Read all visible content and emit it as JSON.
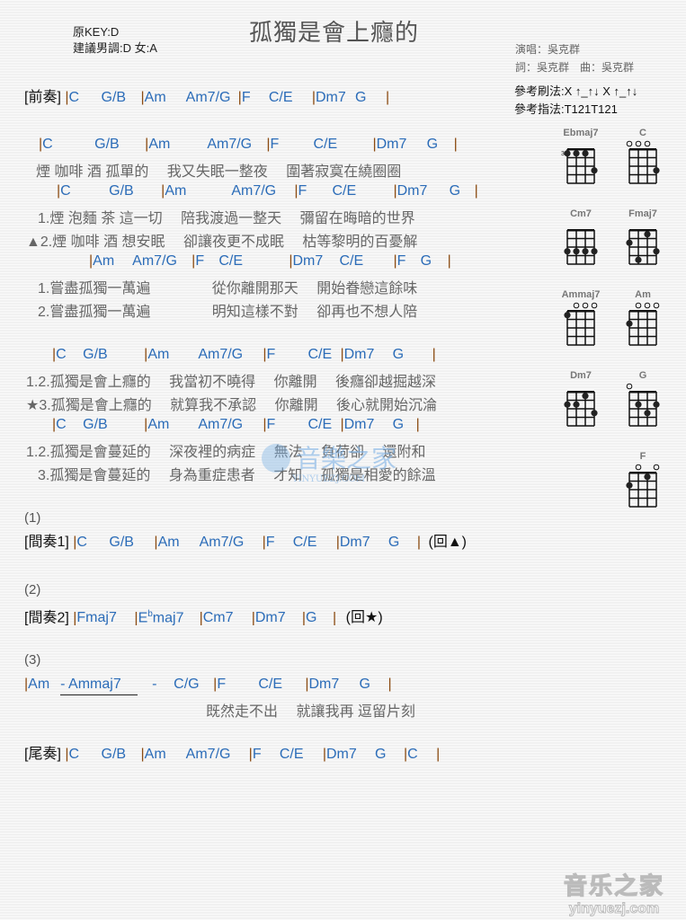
{
  "header": {
    "original_key": "原KEY:D",
    "suggested_key": "建議男調:D 女:A",
    "title": "孤獨是會上癮的",
    "singer": "演唱：吳克群",
    "credits": "詞：吳克群　曲：吳克群",
    "strum": "參考刷法:X ↑_↑↓ X ↑_↑↓",
    "finger": "參考指法:T121T121"
  },
  "intro": {
    "label": "[前奏]",
    "chords": [
      "C",
      "G/B",
      "Am",
      "Am7/G",
      "F",
      "C/E",
      "Dm7",
      "G"
    ]
  },
  "verse": {
    "chords1": [
      "C",
      "G/B",
      "Am",
      "Am7/G",
      "F",
      "C/E",
      "Dm7",
      "G"
    ],
    "lyric1": "煙 咖啡 酒 孤單的　 我又失眠一整夜　 圍著寂寞在繞圈圈",
    "chords2": [
      "C",
      "G/B",
      "Am",
      "Am7/G",
      "F",
      "C/E",
      "Dm7",
      "G"
    ],
    "lyric2a": "1.煙 泡麵 茶 這一切　 陪我渡過一整天　 彌留在晦暗的世界",
    "lyric2b": "▲2.煙 咖啡 酒 想安眠　 卻讓夜更不成眠　 枯等黎明的百憂解",
    "chords3": [
      "Am",
      "Am7/G",
      "F",
      "C/E",
      "Dm7",
      "C/E",
      "F",
      "G"
    ],
    "lyric3a": "1.嘗盡孤獨一萬遍　　　　 從你離開那天　 開始眷戀這餘味",
    "lyric3b": "2.嘗盡孤獨一萬遍　　　　 明知這樣不對　 卻再也不想人陪"
  },
  "chorus": {
    "chords1": [
      "C",
      "G/B",
      "Am",
      "Am7/G",
      "F",
      "C/E",
      "Dm7",
      "G"
    ],
    "lyric1a": "1.2.孤獨是會上癮的　 我當初不曉得　 你離開　 後癮卻越掘越深",
    "lyric1b": "★3.孤獨是會上癮的　 就算我不承認　 你離開　 後心就開始沉淪",
    "chords2": [
      "C",
      "G/B",
      "Am",
      "Am7/G",
      "F",
      "C/E",
      "Dm7",
      "G"
    ],
    "lyric2a": "1.2.孤獨是會蔓延的　 深夜裡的病症　 無法　 負荷卻　 還附和",
    "lyric2b": "3.孤獨是會蔓延的　 身為重症患者　 才知　 孤獨是相愛的餘溫"
  },
  "section1": {
    "marker": "(1)",
    "label": "[間奏1]",
    "chords": [
      "C",
      "G/B",
      "Am",
      "Am7/G",
      "F",
      "C/E",
      "Dm7",
      "G"
    ],
    "return": "(回▲)"
  },
  "section2": {
    "marker": "(2)",
    "label": "[間奏2]",
    "chords": [
      "Fmaj7",
      "E",
      "b",
      "maj7",
      "Cm7",
      "Dm7",
      "G"
    ],
    "return": "(回★)"
  },
  "section3": {
    "marker": "(3)",
    "chords": [
      "Am",
      "-  Ammaj7",
      "-",
      "C/G",
      "F",
      "C/E",
      "Dm7",
      "G"
    ],
    "lyric": "既然走不出　 就讓我再 逗留片刻"
  },
  "outro": {
    "label": "[尾奏]",
    "chords": [
      "C",
      "G/B",
      "Am",
      "Am7/G",
      "F",
      "C/E",
      "Dm7",
      "G",
      "C"
    ]
  },
  "chord_diagrams": [
    {
      "name": "Ebmaj7",
      "open": [],
      "fret_label": "3",
      "dots": [
        [
          1,
          1
        ],
        [
          2,
          1
        ],
        [
          3,
          1
        ],
        [
          4,
          3
        ]
      ]
    },
    {
      "name": "C",
      "open": [
        1,
        2,
        3
      ],
      "fret_label": "",
      "dots": [
        [
          4,
          3
        ]
      ]
    },
    {
      "name": "Cm7",
      "open": [],
      "fret_label": "",
      "dots": [
        [
          1,
          3
        ],
        [
          2,
          3
        ],
        [
          3,
          3
        ],
        [
          4,
          3
        ]
      ]
    },
    {
      "name": "Fmaj7",
      "open": [],
      "fret_label": "",
      "dots": [
        [
          1,
          2
        ],
        [
          2,
          4
        ],
        [
          3,
          1
        ],
        [
          4,
          3
        ]
      ]
    },
    {
      "name": "Ammaj7",
      "open": [
        2,
        3,
        4
      ],
      "fret_label": "",
      "dots": [
        [
          1,
          1
        ]
      ]
    },
    {
      "name": "Am",
      "open": [
        2,
        3,
        4
      ],
      "fret_label": "",
      "dots": [
        [
          1,
          2
        ]
      ]
    },
    {
      "name": "Dm7",
      "open": [],
      "fret_label": "",
      "dots": [
        [
          1,
          2
        ],
        [
          2,
          2
        ],
        [
          3,
          1
        ],
        [
          4,
          3
        ]
      ]
    },
    {
      "name": "G",
      "open": [
        1
      ],
      "fret_label": "",
      "dots": [
        [
          2,
          2
        ],
        [
          3,
          3
        ],
        [
          4,
          2
        ]
      ]
    },
    {
      "name": "F",
      "open": [
        2,
        4
      ],
      "fret_label": "",
      "dots": [
        [
          1,
          2
        ],
        [
          3,
          1
        ]
      ]
    }
  ],
  "watermark": {
    "center_text": "音樂之家",
    "center_sub": "YINYUEZJ.COM",
    "corner_text": "音乐之家",
    "corner_sub": "yinyuezj.com"
  }
}
